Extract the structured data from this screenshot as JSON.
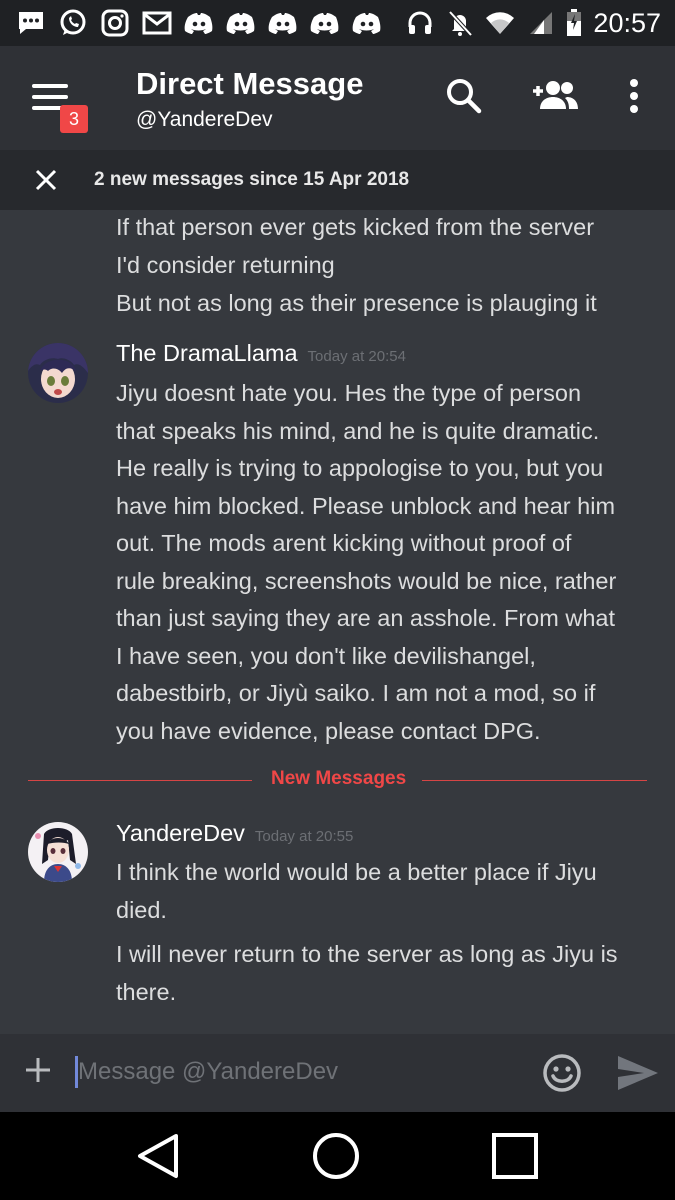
{
  "status_bar": {
    "time": "20:57",
    "left_icons": [
      "sms-icon",
      "whatsapp-icon",
      "instagram-icon",
      "gmail-icon",
      "discord-icon",
      "discord-icon",
      "discord-icon",
      "discord-icon",
      "discord-icon"
    ],
    "right_icons": [
      "headphones-icon",
      "mute-icon",
      "wifi-icon",
      "signal-icon",
      "battery-icon"
    ]
  },
  "app_bar": {
    "title": "Direct Message",
    "subtitle": "@YandereDev",
    "badge": "3"
  },
  "notice": {
    "text": "2 new messages since 15 Apr 2018"
  },
  "messages": [
    {
      "continuation": true,
      "lines": [
        "If that person ever gets kicked from the server",
        "I'd consider returning",
        "But not as long as their presence is plauging it"
      ]
    },
    {
      "author": "The DramaLlama",
      "timestamp": "Today at 20:54",
      "lines": [
        "Jiyu doesnt hate you. Hes the type of person",
        "that speaks his mind, and he is quite dramatic.",
        "He really is trying to appologise to you, but you",
        "have him blocked. Please unblock and hear him",
        "out. The mods arent kicking without proof of",
        "rule breaking, screenshots would be nice, rather",
        "than just saying they are an asshole. From what",
        "I have seen, you don't like devilishangel,",
        "dabestbirb, or Jiyù saiko. I am not a mod, so if",
        "you have evidence, please contact DPG."
      ]
    },
    {
      "author": "YandereDev",
      "timestamp": "Today at 20:55",
      "lines": [
        "I think the world would be a better place if Jiyu",
        "died.",
        "I will never return to the server as long as Jiyu is",
        "there."
      ]
    }
  ],
  "divider": {
    "label": "New Messages"
  },
  "composer": {
    "placeholder": "Message @YandereDev"
  },
  "colors": {
    "background": "#36393e",
    "app_bar": "#2f3136",
    "accent_red": "#f04747",
    "caret_blue": "#7289da"
  }
}
